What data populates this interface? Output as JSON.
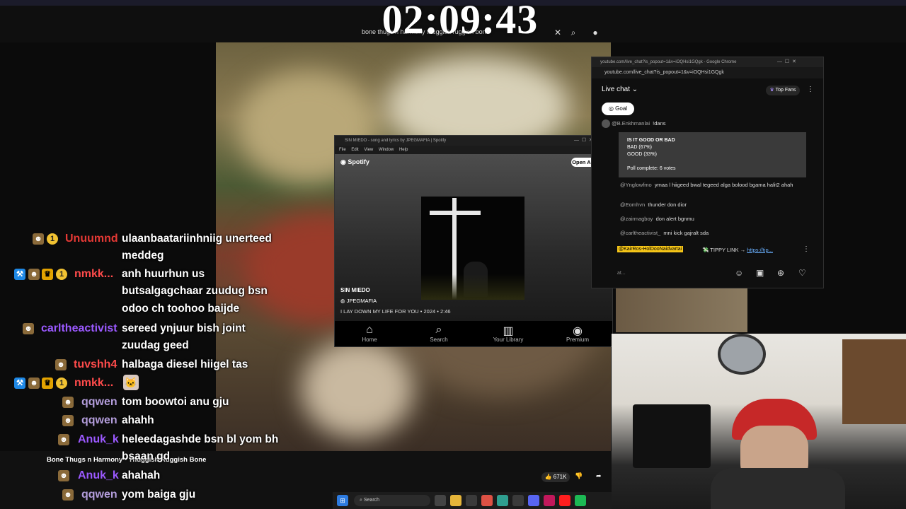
{
  "clock": "02:09:43",
  "search": {
    "query": "bone thugs n harmony thuggish ruggish bone"
  },
  "chat_overlay": [
    {
      "user": "Unuumnd",
      "color": "#e53935",
      "lines": [
        "ulaanbaatariinhniig unerteed",
        "meddeg"
      ]
    },
    {
      "user": "nmkk...",
      "color": "#ff4b4b",
      "lines": [
        "anh huurhun us",
        "butsalgagchaar zuudug bsn",
        "odoo ch toohoo baijde"
      ]
    },
    {
      "user": "carltheactivist",
      "color": "#9b59ff",
      "lines": [
        "sereed ynjuur bish joint",
        "zuudag geed"
      ]
    },
    {
      "user": "tuvshh4",
      "color": "#ff4b4b",
      "lines": [
        "halbaga diesel hiigel tas"
      ]
    },
    {
      "user": "nmkk...",
      "color": "#ff4b4b",
      "lines": [
        ""
      ]
    },
    {
      "user": "qqwen",
      "color": "#b39ddb",
      "lines": [
        "tom boowtoi anu gju"
      ]
    },
    {
      "user": "qqwen",
      "color": "#b39ddb",
      "lines": [
        "ahahh"
      ]
    },
    {
      "user": "Anuk_k",
      "color": "#9b59ff",
      "lines": [
        "heleedagashde bsn bl yom bh",
        "bsaan gd"
      ]
    },
    {
      "user": "Anuk_k",
      "color": "#9b59ff",
      "lines": [
        "ahahah"
      ]
    },
    {
      "user": "qqwen",
      "color": "#b39ddb",
      "lines": [
        "yom baiga gju"
      ]
    }
  ],
  "video_info": {
    "title": "Bone Thugs n Harmony - Thuggish Ruggish Bone",
    "likes": "671K"
  },
  "spotify": {
    "window_title": "SIN MIEDO - song and lyrics by JPEGMAFIA | Spotify",
    "menu": [
      "File",
      "Edit",
      "View",
      "Window",
      "Help"
    ],
    "brand": "Spotify",
    "open_app": "Open App",
    "song": "SIN MIEDO",
    "artist": "JPEGMAFIA",
    "meta": "I LAY DOWN MY LIFE FOR YOU • 2024 • 2:46",
    "nav": [
      "Home",
      "Search",
      "Your Library",
      "Premium"
    ]
  },
  "live_chat": {
    "window_title": "youtube.com/live_chat?is_popout=1&v=iOQHsi1GQgk - Google Chrome",
    "url": "youtube.com/live_chat?is_popout=1&v=iOQHsi1GQgk",
    "header": "Live chat",
    "top_fans": "Top Fans",
    "goal": "Goal",
    "first_msg_user": "@B.Enkhmanlai",
    "first_msg_text": "!dans",
    "poll": {
      "question": "IS IT GOOD OR BAD",
      "options": [
        "BAD (67%)",
        "GOOD (33%)"
      ],
      "status": "Poll complete: 6 votes"
    },
    "messages": [
      {
        "user": "@Ynglowfmo",
        "text": "ymaa l hiigeed bwal tegeed alga bolood bgama halit2 ahah"
      },
      {
        "user": "@Eomhvn",
        "text": "thunder don dior"
      },
      {
        "user": "@zairmagboy",
        "text": "don alert bgnmu"
      },
      {
        "user": "@carltheactivist_",
        "text": "mni kick gajralt sda"
      }
    ],
    "pinned_user": "@KairRos-HolDooNaidvartai",
    "pinned_text": "TIPPY LINK →",
    "pinned_link": "https://tip...",
    "input_placeholder": "at..."
  },
  "taskbar": {
    "search": "Search"
  }
}
